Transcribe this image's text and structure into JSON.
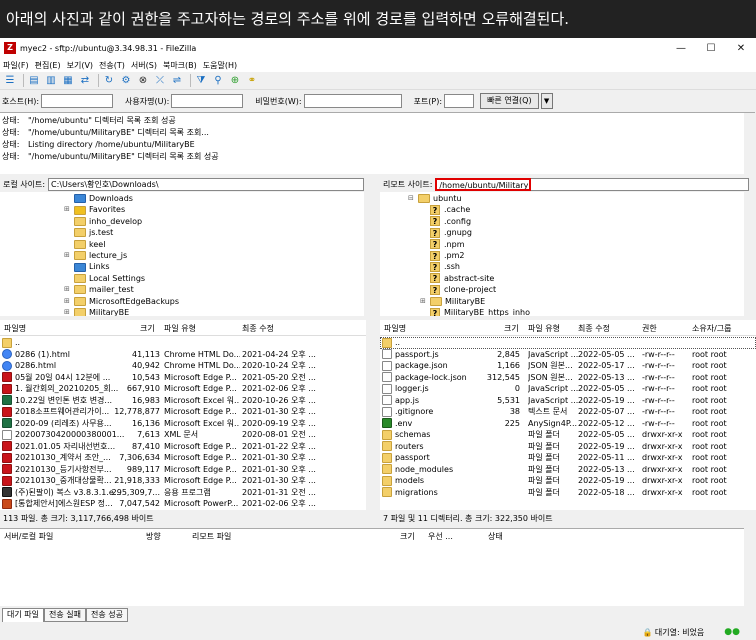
{
  "caption": "아래의 사진과 같이 권한을 주고자하는 경로의 주소를 위에 경로를 입력하면 오류해결된다.",
  "window": {
    "title": "myec2 - sftp://ubuntu@3.34.98.31 - FileZilla",
    "minimize": "—",
    "maximize": "☐",
    "close": "✕"
  },
  "menu": [
    "파일(F)",
    "편집(E)",
    "보기(V)",
    "전송(T)",
    "서버(S)",
    "북마크(B)",
    "도움말(H)"
  ],
  "toolbar": {
    "icons": [
      "site-manager-icon",
      "toggle-log-icon",
      "toggle-local-tree-icon",
      "toggle-remote-tree-icon",
      "toggle-queue-icon",
      "refresh-icon",
      "process-queue-icon",
      "cancel-icon",
      "disconnect-icon",
      "reconnect-icon",
      "filter-icon",
      "compare-icon",
      "sync-browse-icon",
      "search-icon"
    ]
  },
  "quickconnect": {
    "host_label": "호스트(H):",
    "user_label": "사용자명(U):",
    "pass_label": "비밀번호(W):",
    "port_label": "포트(P):",
    "button": "빠른 연결(Q)",
    "dropdown": "▼"
  },
  "log": [
    {
      "label": "상태:",
      "text": "\"/home/ubuntu\" 디렉터리 목록 조회 성공"
    },
    {
      "label": "상태:",
      "text": "\"/home/ubuntu/MilitaryBE\" 디렉터리 목록 조회..."
    },
    {
      "label": "상태:",
      "text": "Listing directory /home/ubuntu/MilitaryBE"
    },
    {
      "label": "상태:",
      "text": "\"/home/ubuntu/MilitaryBE\" 디렉터리 목록 조회 성공"
    }
  ],
  "local": {
    "site_label": "로컬 사이트:",
    "site_path": "C:\\Users\\황인호\\Downloads\\",
    "tree": [
      "Downloads",
      "Favorites",
      "inho_develop",
      "js.test",
      "keel",
      "lecture_js",
      "Links",
      "Local Settings",
      "mailer_test",
      "MicrosoftEdgeBackups",
      "MilitaryBE"
    ],
    "headers": {
      "name": "파일명",
      "size": "크기",
      "type": "파일 유형",
      "modified": "최종 수정"
    },
    "files": [
      {
        "name": "..",
        "size": "",
        "type": "",
        "modified": "",
        "icon": "folder"
      },
      {
        "name": "0286 (1).html",
        "size": "41,113",
        "type": "Chrome HTML Do...",
        "modified": "2021-04-24 오후 ...",
        "icon": "chrome"
      },
      {
        "name": "0286.html",
        "size": "40,942",
        "type": "Chrome HTML Do...",
        "modified": "2020-10-24 오후 ...",
        "icon": "chrome"
      },
      {
        "name": "05월 20일 04시 12분에 ...",
        "size": "10,543",
        "type": "Microsoft Edge P...",
        "modified": "2021-05-20 오전 ...",
        "icon": "pdf"
      },
      {
        "name": "1. 월간회의_20210205_회...",
        "size": "667,910",
        "type": "Microsoft Edge P...",
        "modified": "2021-02-06 오후 ...",
        "icon": "pdf"
      },
      {
        "name": "10.22일 변인톤 변호 변경...",
        "size": "16,983",
        "type": "Microsoft Excel 워...",
        "modified": "2020-10-26 오후 ...",
        "icon": "excel"
      },
      {
        "name": "2018소프트웨어관리가이...",
        "size": "12,778,877",
        "type": "Microsoft Edge P...",
        "modified": "2021-01-30 오후 ...",
        "icon": "pdf"
      },
      {
        "name": "2020-09 (리레조) 사무용...",
        "size": "16,136",
        "type": "Microsoft Excel 워...",
        "modified": "2020-09-19 오후 ...",
        "icon": "excel"
      },
      {
        "name": "20200730420000380001...",
        "size": "7,613",
        "type": "XML 문서",
        "modified": "2020-08-01 오전 ...",
        "icon": "xml"
      },
      {
        "name": "2021.01.05 자리내선번호...",
        "size": "87,410",
        "type": "Microsoft Edge P...",
        "modified": "2021-01-22 오후 ...",
        "icon": "pdf"
      },
      {
        "name": "20210130_계약서 조안_...",
        "size": "7,306,634",
        "type": "Microsoft Edge P...",
        "modified": "2021-01-30 오후 ...",
        "icon": "pdf"
      },
      {
        "name": "20210130_등기사항전부...",
        "size": "989,117",
        "type": "Microsoft Edge P...",
        "modified": "2021-01-30 오후 ...",
        "icon": "pdf"
      },
      {
        "name": "20210130_중개대상물확...",
        "size": "21,918,333",
        "type": "Microsoft Edge P...",
        "modified": "2021-01-30 오후 ...",
        "icon": "pdf"
      },
      {
        "name": "(주)된팔이) 복스 v3.8.3.1.e...",
        "size": "295,309,7...",
        "type": "응용 프로그램",
        "modified": "2021-01-31 오전 ...",
        "icon": "app"
      },
      {
        "name": "[통합제안서]에스원ESP 정...",
        "size": "7,047,542",
        "type": "Microsoft PowerP...",
        "modified": "2021-02-06 오후 ...",
        "icon": "ppt"
      }
    ],
    "status": "113 파일. 총 크기: 3,117,766,498 바이트"
  },
  "remote": {
    "site_label": "리모트 사이트:",
    "site_path": "/home/ubuntu/MilitaryBE",
    "tree": [
      {
        "name": "ubuntu",
        "q": false,
        "indent": 1,
        "exp": "⊟"
      },
      {
        "name": ".cache",
        "q": true,
        "indent": 2,
        "exp": ""
      },
      {
        "name": ".config",
        "q": true,
        "indent": 2,
        "exp": ""
      },
      {
        "name": ".gnupg",
        "q": true,
        "indent": 2,
        "exp": ""
      },
      {
        "name": ".npm",
        "q": true,
        "indent": 2,
        "exp": ""
      },
      {
        "name": ".pm2",
        "q": true,
        "indent": 2,
        "exp": ""
      },
      {
        "name": ".ssh",
        "q": true,
        "indent": 2,
        "exp": ""
      },
      {
        "name": "abstract-site",
        "q": true,
        "indent": 2,
        "exp": ""
      },
      {
        "name": "clone-project",
        "q": true,
        "indent": 2,
        "exp": ""
      },
      {
        "name": "MilitaryBE",
        "q": false,
        "indent": 2,
        "exp": "⊞"
      },
      {
        "name": "MilitaryBE_https_inho",
        "q": true,
        "indent": 2,
        "exp": ""
      }
    ],
    "headers": {
      "name": "파일명",
      "size": "크기",
      "type": "파일 유형",
      "modified": "최종 수정",
      "perm": "권한",
      "owner": "소유자/그룹"
    },
    "files": [
      {
        "name": "..",
        "size": "",
        "type": "",
        "modified": "",
        "perm": "",
        "owner": "",
        "icon": "folder"
      },
      {
        "name": "passport.js",
        "size": "2,845",
        "type": "JavaScript ...",
        "modified": "2022-05-05 ...",
        "perm": "-rw-r--r--",
        "owner": "root root",
        "icon": "file"
      },
      {
        "name": "package.json",
        "size": "1,166",
        "type": "JSON 원본...",
        "modified": "2022-05-17 ...",
        "perm": "-rw-r--r--",
        "owner": "root root",
        "icon": "file"
      },
      {
        "name": "package-lock.json",
        "size": "312,545",
        "type": "JSON 원본...",
        "modified": "2022-05-13 ...",
        "perm": "-rw-r--r--",
        "owner": "root root",
        "icon": "file"
      },
      {
        "name": "logger.js",
        "size": "0",
        "type": "JavaScript ...",
        "modified": "2022-05-05 ...",
        "perm": "-rw-r--r--",
        "owner": "root root",
        "icon": "file"
      },
      {
        "name": "app.js",
        "size": "5,531",
        "type": "JavaScript ...",
        "modified": "2022-05-19 ...",
        "perm": "-rw-r--r--",
        "owner": "root root",
        "icon": "file"
      },
      {
        "name": ".gitignore",
        "size": "38",
        "type": "텍스트 문서",
        "modified": "2022-05-07 ...",
        "perm": "-rw-r--r--",
        "owner": "root root",
        "icon": "file"
      },
      {
        "name": ".env",
        "size": "225",
        "type": "AnySign4P...",
        "modified": "2022-05-12 ...",
        "perm": "-rw-r--r--",
        "owner": "root root",
        "icon": "env"
      },
      {
        "name": "schemas",
        "size": "",
        "type": "파일 폴더",
        "modified": "2022-05-05 ...",
        "perm": "drwxr-xr-x",
        "owner": "root root",
        "icon": "folder"
      },
      {
        "name": "routers",
        "size": "",
        "type": "파일 폴더",
        "modified": "2022-05-19 ...",
        "perm": "drwxr-xr-x",
        "owner": "root root",
        "icon": "folder"
      },
      {
        "name": "passport",
        "size": "",
        "type": "파일 폴더",
        "modified": "2022-05-11 ...",
        "perm": "drwxr-xr-x",
        "owner": "root root",
        "icon": "folder"
      },
      {
        "name": "node_modules",
        "size": "",
        "type": "파일 폴더",
        "modified": "2022-05-13 ...",
        "perm": "drwxr-xr-x",
        "owner": "root root",
        "icon": "folder"
      },
      {
        "name": "models",
        "size": "",
        "type": "파일 폴더",
        "modified": "2022-05-19 ...",
        "perm": "drwxr-xr-x",
        "owner": "root root",
        "icon": "folder"
      },
      {
        "name": "migrations",
        "size": "",
        "type": "파일 폴더",
        "modified": "2022-05-18 ...",
        "perm": "drwxr-xr-x",
        "owner": "root root",
        "icon": "folder"
      }
    ],
    "status": "7 파일 및 11 디렉터리. 총 크기: 322,350 바이트"
  },
  "queue": {
    "headers": [
      "서버/로컬 파일",
      "방향",
      "리모트 파일",
      "크기",
      "우선 ...",
      "상태"
    ]
  },
  "tabs": [
    "대기 파일",
    "전송 실패",
    "전송 성공"
  ],
  "footer": {
    "queue_label": "대기열: 비었음"
  },
  "colors": {
    "highlight": "#e00000",
    "folder": "#f3cf69",
    "pdf": "#c9141a",
    "excel": "#1f7244",
    "chrome": "#4285f4"
  }
}
